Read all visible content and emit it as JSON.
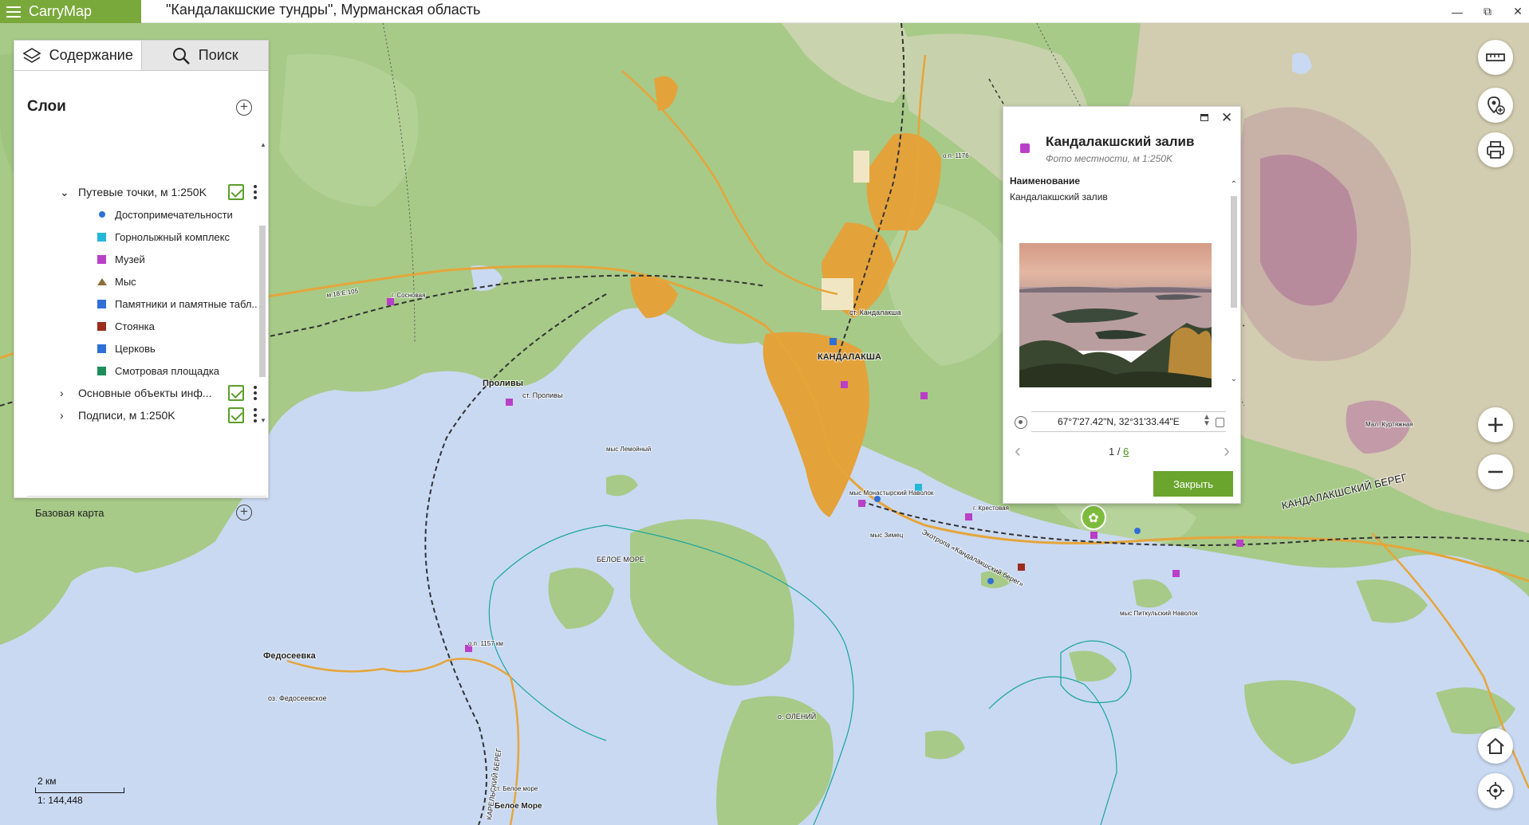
{
  "app": {
    "name": "CarryMap",
    "window_title": "\"Кандалакшские тундры\", Мурманская область"
  },
  "tabs": {
    "contents": "Содержание",
    "search": "Поиск"
  },
  "layers": {
    "heading": "Слои",
    "groups": [
      {
        "label": "Путевые точки, м 1:250K",
        "expanded": true,
        "checked": true
      },
      {
        "label": "Основные объекты инф...",
        "expanded": false,
        "checked": true
      },
      {
        "label": "Подписи, м 1:250K",
        "expanded": false,
        "checked": true
      }
    ],
    "sublayers": [
      {
        "label": "Достопримечательности",
        "color": "#2f6fd6",
        "shape": "dot"
      },
      {
        "label": "Горнолыжный комплекс",
        "color": "#25b7d8",
        "shape": "square"
      },
      {
        "label": "Музей",
        "color": "#b93fc8",
        "shape": "square"
      },
      {
        "label": "Мыс",
        "color": "#8a6f3a",
        "shape": "triangle"
      },
      {
        "label": "Памятники и памятные табл...",
        "color": "#2f6fd6",
        "shape": "square"
      },
      {
        "label": "Стоянка",
        "color": "#9b2c1e",
        "shape": "square"
      },
      {
        "label": "Церковь",
        "color": "#2f6fd6",
        "shape": "square"
      },
      {
        "label": "Смотровая площадка",
        "color": "#1d8e5a",
        "shape": "square"
      }
    ],
    "basemap_label": "Базовая карта"
  },
  "popup": {
    "title": "Кандалакшский залив",
    "subtitle": "Фото местности, м 1:250K",
    "field_name": "Наименование",
    "field_value": "Кандалакшский залив",
    "coordinates": "67°7'27.42\"N, 32°31'33.44\"E",
    "page_current": "1",
    "page_sep": " / ",
    "page_total": "6",
    "close_label": "Закрыть"
  },
  "scale": {
    "distance": "2 км",
    "ratio": "1: 144,448"
  },
  "map_labels": [
    {
      "text": "КАНДАЛАКША",
      "bold": true
    },
    {
      "text": "Проливы",
      "bold": true
    },
    {
      "text": "Федосеевка",
      "bold": true
    },
    {
      "text": "Белое Море",
      "bold": true
    },
    {
      "text": "БЕЛОЕ МОРЕ",
      "bold": false
    },
    {
      "text": "о. ОЛЕНИЙ",
      "bold": false
    },
    {
      "text": "оз. Федосеевское",
      "bold": false
    },
    {
      "text": "КАНДАЛАКШСКИЙ БЕРЕГ",
      "bold": false
    },
    {
      "text": "КАРЕЛЬСКИЙ БЕРЕГ",
      "bold": false
    },
    {
      "text": "ст. Кандалакша",
      "bold": false
    },
    {
      "text": "ст. Проливы",
      "bold": false
    },
    {
      "text": "г. Сосновая",
      "bold": false
    },
    {
      "text": "г. Крестовая",
      "bold": false
    },
    {
      "text": "мыс Лемойный",
      "bold": false
    },
    {
      "text": "мыс Монастырский Наволок",
      "bold": false
    },
    {
      "text": "мыс Зимец",
      "bold": false
    },
    {
      "text": "мыс Питкульский Наволок",
      "bold": false
    },
    {
      "text": "Мал. Куртяжная",
      "bold": false
    },
    {
      "text": "о.п. 1157 км",
      "bold": false
    },
    {
      "text": "о.п. 1176",
      "bold": false
    },
    {
      "text": "ст. Белое море",
      "bold": false
    },
    {
      "text": "м.18.Е.105",
      "bold": false
    },
    {
      "text": "Экотропа «Кандалакшский берег»",
      "bold": false
    }
  ],
  "colors": {
    "brand": "#79a93a",
    "water": "#c9d9f2",
    "forest": "#a7ca88",
    "forest_dark": "#8dba6e",
    "highland": "#d7c8b2",
    "mountain": "#b78b9c",
    "urban": "#e4a23b",
    "road": "#e6a53a",
    "isobath": "#1aa59c",
    "accent": "#6aa52e"
  }
}
